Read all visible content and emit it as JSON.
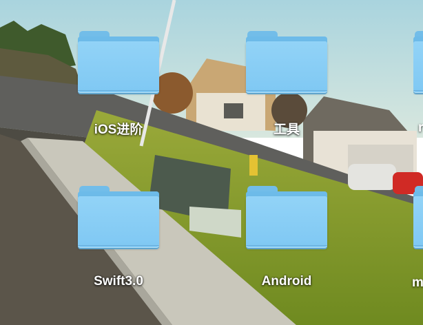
{
  "desktop": {
    "items": [
      {
        "label": "iOS进阶"
      },
      {
        "label": "工具"
      },
      {
        "label": "Swift3.0"
      },
      {
        "label": "Android"
      }
    ],
    "edge_items": [
      {
        "label": "r"
      },
      {
        "label": "m"
      }
    ]
  },
  "colors": {
    "folder_front": "#88cef5",
    "folder_back": "#6dbbe9",
    "label_text": "#ffffff"
  }
}
